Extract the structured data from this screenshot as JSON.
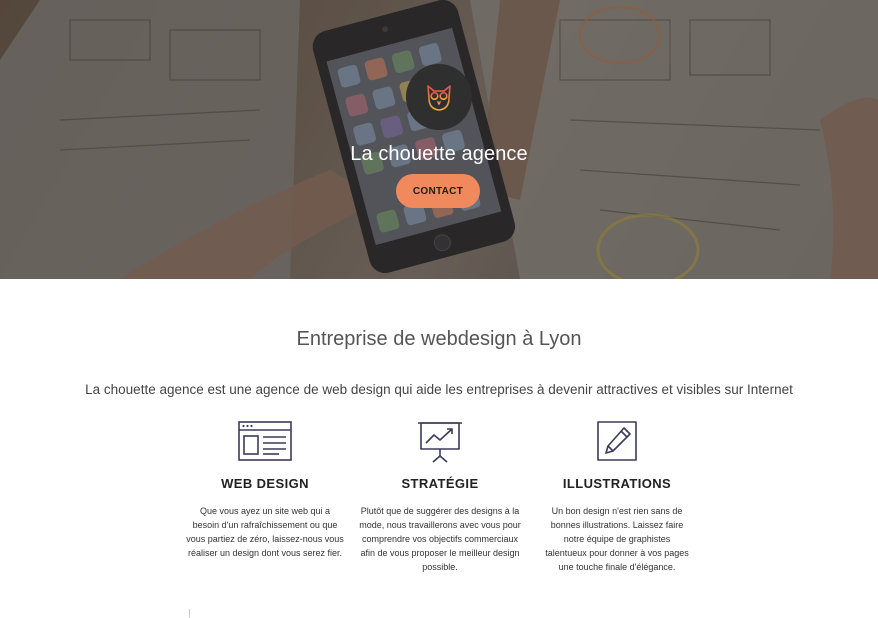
{
  "hero": {
    "title": "La chouette agence",
    "contact_button": "CONTACT",
    "logo_icon": "owl-logo-icon",
    "accent_color": "#f08a5d"
  },
  "main": {
    "title": "Entreprise de webdesign à Lyon",
    "intro": "La chouette agence est une agence de web design qui aide les entreprises à devenir attractives et visibles sur Internet"
  },
  "services": [
    {
      "icon": "browser-window-icon",
      "title": "WEB DESIGN",
      "text": "Que vous ayez un site web qui a besoin d'un rafraîchissement ou que vous partiez de zéro, laissez-nous vous réaliser un design dont vous serez fier."
    },
    {
      "icon": "presentation-chart-icon",
      "title": "STRATÉGIE",
      "text": "Plutôt que de suggérer des designs à la mode, nous travaillerons avec vous pour comprendre vos objectifs commerciaux afin de vous proposer le meilleur design possible."
    },
    {
      "icon": "pencil-square-icon",
      "title": "ILLUSTRATIONS",
      "text": "Un bon design n'est rien sans de bonnes illustrations. Laissez faire notre équipe de graphistes talentueux pour donner à vos pages une touche finale d'élégance."
    }
  ]
}
